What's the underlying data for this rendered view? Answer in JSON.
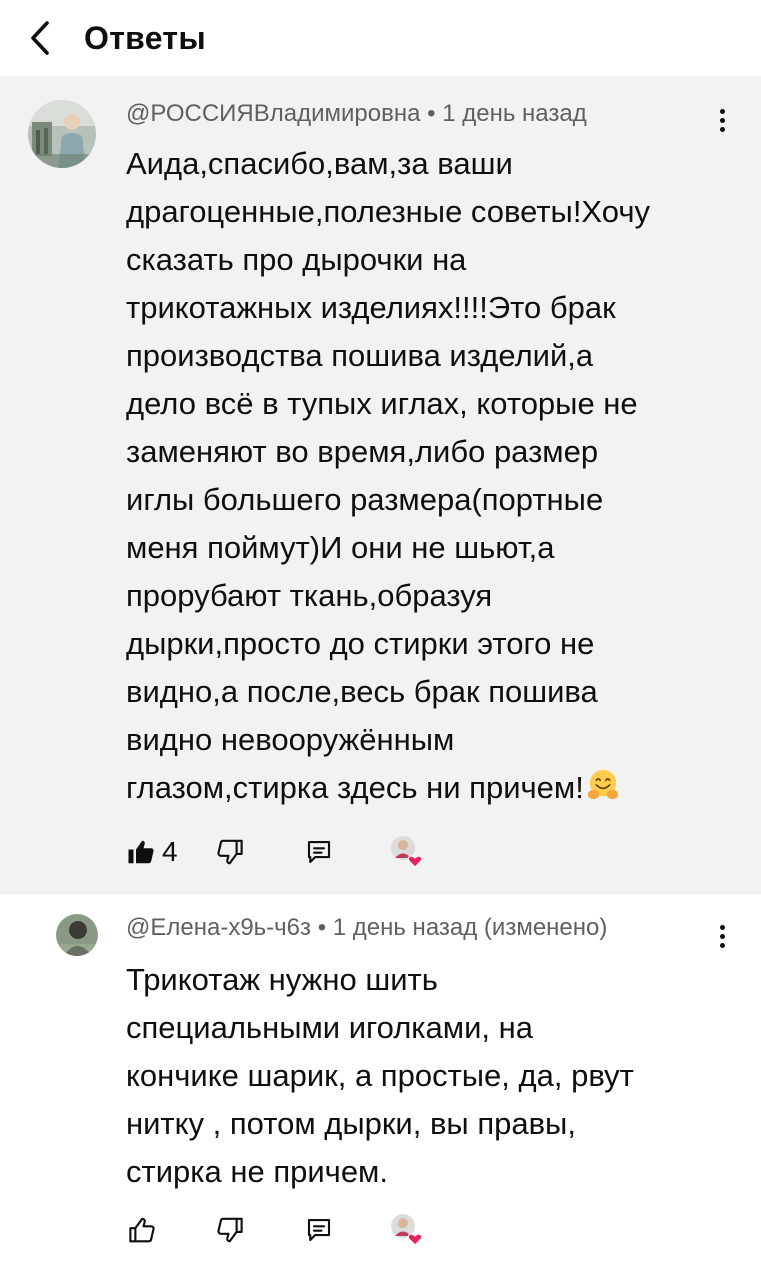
{
  "header": {
    "title": "Ответы",
    "back_icon": "chevron-left-icon"
  },
  "comments": [
    {
      "author": "@РОССИЯВладимировна",
      "separator": "•",
      "time": "1 день назад",
      "text": "Аида,спасибо,вам,за ваши\nдрагоценные,полезные советы!Хочу\nсказать про дырочки на\nтрикотажных изделиях!!!!Это брак\nпроизводства пошива изделий,а\nдело всё в тупых иглах, которые не\nзаменяют во время,либо размер\nиглы большего размера(портные\nменя поймут)И они не шьют,а\nпрорубают ткань,образуя\nдырки,просто до стирки этого не\nвидно,а после,весь брак пошива\nвидно невооружённым\nглазом,стирка здесь ни причем!",
      "emoji": "hugging-face-emoji",
      "likes": "4",
      "liked": true
    },
    {
      "author": "@Елена-х9ь-ч6з",
      "separator": "•",
      "time": "1 день назад (изменено)",
      "text": "Трикотаж нужно шить\nспециальными иголками, на\nкончике шарик, а простые, да, рвут\nнитку , потом дырки, вы правы,\nстирка не причем.",
      "likes": "",
      "liked": false
    }
  ],
  "colors": {
    "parent_bg": "#f2f2f2",
    "meta_text": "#606060",
    "heart": "#e5265d"
  }
}
